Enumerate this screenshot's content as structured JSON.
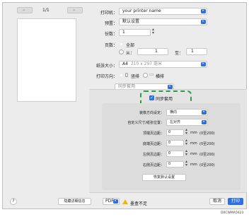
{
  "preview": {
    "prev_icon": "double-chevron-left-icon",
    "next_icon": "double-chevron-right-icon",
    "page_indicator": "1/1"
  },
  "printer": {
    "label": "打印机：",
    "value": "your printer name"
  },
  "preset": {
    "label": "预置：",
    "value": "默认设置"
  },
  "copies": {
    "label": "份数：",
    "value": "1"
  },
  "pages": {
    "label": "页数：",
    "all": "全部",
    "from": "从：",
    "from_value": "1",
    "to": "至：",
    "to_value": "1"
  },
  "paper_size": {
    "label": "纸张大小：",
    "value": "A4",
    "detail": "210 x 297 毫米"
  },
  "orientation": {
    "label": "打印方向：",
    "portrait": "竖排",
    "landscape": "横排"
  },
  "section": {
    "value": "同步套用"
  },
  "sync": {
    "label": "同步套用",
    "checked": true
  },
  "binding_direction": {
    "label": "装像方向设定：",
    "value": "横向"
  },
  "custom_size": {
    "label": "自定义尺寸/纸张位置：",
    "value": "左对齐"
  },
  "margins": [
    {
      "label": "顶端页边距：",
      "value": "0",
      "unit": "mm",
      "range": "(0至200)"
    },
    {
      "label": "底端页边距：",
      "value": "0",
      "unit": "mm",
      "range": "(0至200)"
    },
    {
      "label": "左侧页边距：",
      "value": "0",
      "unit": "mm",
      "range": "(0至200)"
    },
    {
      "label": "右侧页边距：",
      "value": "0",
      "unit": "mm",
      "range": "(0至200)"
    }
  ],
  "restore_defaults": "恢复默认设置",
  "help": "?",
  "hide_details": "隐藏详细信息",
  "pdf": "PDF",
  "warning_icon": "warning-icon",
  "warning_text": "墨盒不足",
  "cancel": "取消",
  "print": "打印",
  "image_code": "D0CWMA5623",
  "colors": {
    "accent": "#2f6fde",
    "highlight": "#2b9d43",
    "warning": "#f5b400"
  }
}
